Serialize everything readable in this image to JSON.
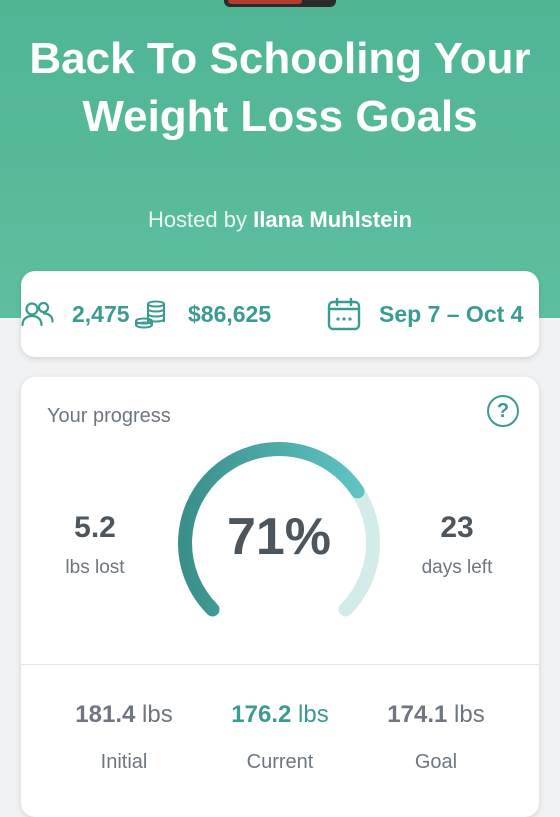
{
  "challenge": {
    "title": "Back To Schooling Your Weight Loss Goals",
    "hosted_by_label": "Hosted by",
    "host_name": "Ilana Muhlstein"
  },
  "stats": {
    "participants": "2,475",
    "pot": "$86,625",
    "dates": "Sep 7 – Oct 4",
    "icons": [
      "people-icon",
      "coins-icon",
      "calendar-icon"
    ]
  },
  "progress": {
    "label": "Your progress",
    "percent_text": "71%",
    "percent_value": 71,
    "lost_value": "5.2",
    "lost_label": "lbs lost",
    "days_value": "23",
    "days_label": "days left",
    "initial_value": "181.4",
    "initial_label": "Initial",
    "current_value": "176.2",
    "current_label": "Current",
    "goal_value": "174.1",
    "goal_label": "Goal",
    "unit": "lbs"
  },
  "colors": {
    "brand_green": "#5dbf9f",
    "accent_teal": "#3a9b93",
    "gauge_track": "#d3ece9"
  }
}
